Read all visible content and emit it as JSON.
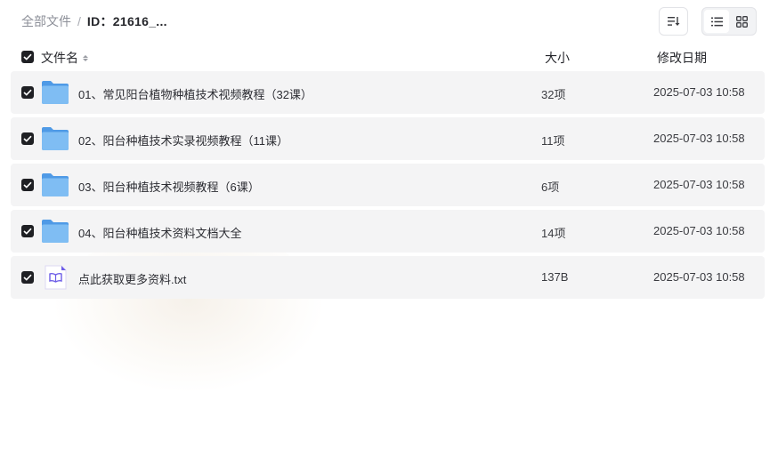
{
  "breadcrumb": {
    "root": "全部文件",
    "separator": "/",
    "current": "ID：21616_..."
  },
  "toolbar": {
    "sort_icon": "sort-icon",
    "list_view_icon": "list-view-icon",
    "grid_view_icon": "grid-view-icon",
    "active_view": "list"
  },
  "table": {
    "headers": {
      "name": "文件名",
      "size": "大小",
      "date": "修改日期"
    },
    "rows": [
      {
        "name": "01、常见阳台植物种植技术视频教程（32课）",
        "size": "32项",
        "date": "2025-07-03 10:58",
        "type": "folder"
      },
      {
        "name": "02、阳台种植技术实录视频教程（11课）",
        "size": "11项",
        "date": "2025-07-03 10:58",
        "type": "folder"
      },
      {
        "name": "03、阳台种植技术视频教程（6课）",
        "size": "6项",
        "date": "2025-07-03 10:58",
        "type": "folder"
      },
      {
        "name": "04、阳台种植技术资料文档大全",
        "size": "14项",
        "date": "2025-07-03 10:58",
        "type": "folder"
      },
      {
        "name": "点此获取更多资料.txt",
        "size": "137B",
        "date": "2025-07-03 10:58",
        "type": "txt"
      }
    ]
  },
  "colors": {
    "folder": "#5fa9ef",
    "checkbox": "#1f2024",
    "row_bg": "#f4f4f5",
    "txt_icon": "#6c5ce7"
  }
}
